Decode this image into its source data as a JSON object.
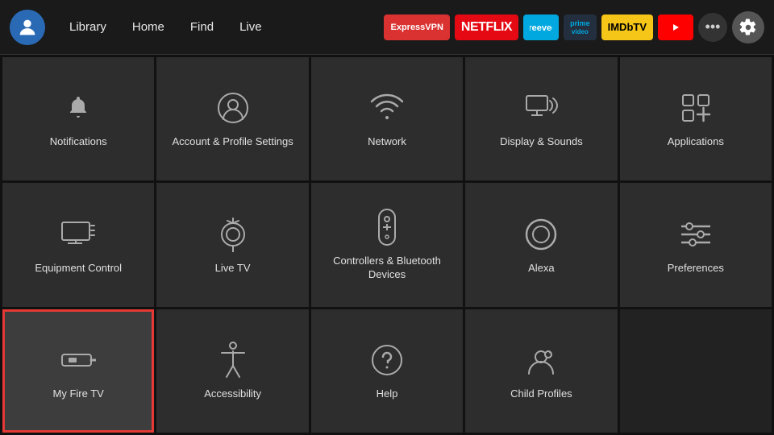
{
  "nav": {
    "links": [
      "Library",
      "Home",
      "Find",
      "Live"
    ],
    "apps": [
      {
        "label": "ExpressVPN",
        "class": "badge-expressvpn"
      },
      {
        "label": "NETFLIX",
        "class": "badge-netflix"
      },
      {
        "label": "≋",
        "class": "badge-freevee"
      },
      {
        "label": "prime video",
        "class": "badge-prime"
      },
      {
        "label": "IMDbTV",
        "class": "badge-imdb"
      },
      {
        "label": "▶ YouTube",
        "class": "badge-youtube"
      }
    ],
    "more_label": "•••",
    "settings_label": "⚙"
  },
  "grid": {
    "items": [
      {
        "id": "notifications",
        "label": "Notifications",
        "icon": "bell"
      },
      {
        "id": "account-profile",
        "label": "Account & Profile Settings",
        "icon": "person-circle"
      },
      {
        "id": "network",
        "label": "Network",
        "icon": "wifi"
      },
      {
        "id": "display-sounds",
        "label": "Display & Sounds",
        "icon": "monitor-sound"
      },
      {
        "id": "applications",
        "label": "Applications",
        "icon": "grid-plus"
      },
      {
        "id": "equipment-control",
        "label": "Equipment Control",
        "icon": "tv-screen"
      },
      {
        "id": "live-tv",
        "label": "Live TV",
        "icon": "antenna"
      },
      {
        "id": "controllers-bluetooth",
        "label": "Controllers & Bluetooth Devices",
        "icon": "remote"
      },
      {
        "id": "alexa",
        "label": "Alexa",
        "icon": "alexa-ring"
      },
      {
        "id": "preferences",
        "label": "Preferences",
        "icon": "sliders"
      },
      {
        "id": "my-fire-tv",
        "label": "My Fire TV",
        "icon": "firestick",
        "selected": true
      },
      {
        "id": "accessibility",
        "label": "Accessibility",
        "icon": "accessibility"
      },
      {
        "id": "help",
        "label": "Help",
        "icon": "question-circle"
      },
      {
        "id": "child-profiles",
        "label": "Child Profiles",
        "icon": "child-profile"
      },
      {
        "id": "empty",
        "label": "",
        "icon": "none"
      }
    ]
  }
}
